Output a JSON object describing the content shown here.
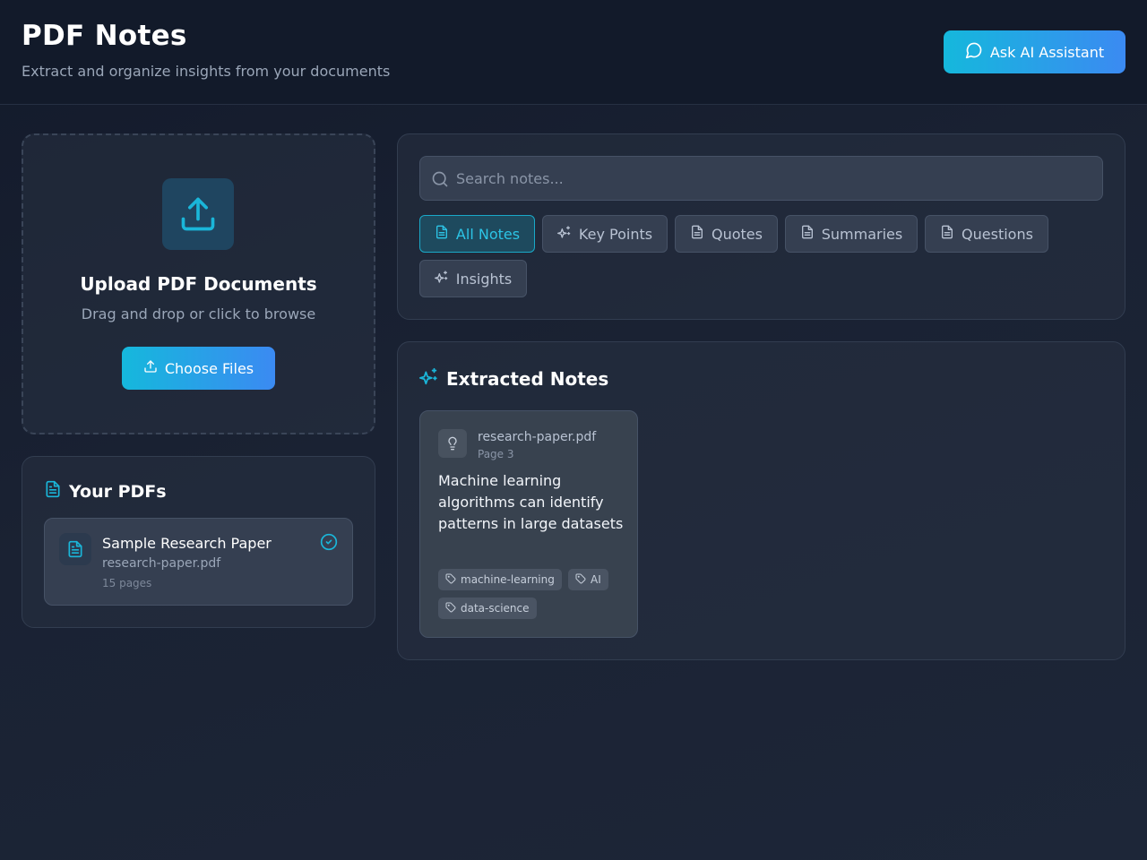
{
  "header": {
    "title": "PDF Notes",
    "subtitle": "Extract and organize insights from your documents",
    "ask_button": "Ask AI Assistant"
  },
  "upload": {
    "title": "Upload PDF Documents",
    "subtitle": "Drag and drop or click to browse",
    "button": "Choose Files"
  },
  "pdfs": {
    "heading": "Your PDFs",
    "items": [
      {
        "name": "Sample Research Paper",
        "file": "research-paper.pdf",
        "pages": "15 pages",
        "status": "selected"
      }
    ]
  },
  "search": {
    "placeholder": "Search notes...",
    "value": ""
  },
  "filters": [
    {
      "label": "All Notes",
      "icon": "file-text-icon",
      "active": true
    },
    {
      "label": "Key Points",
      "icon": "sparkles-icon",
      "active": false
    },
    {
      "label": "Quotes",
      "icon": "file-text-icon",
      "active": false
    },
    {
      "label": "Summaries",
      "icon": "file-text-icon",
      "active": false
    },
    {
      "label": "Questions",
      "icon": "file-text-icon",
      "active": false
    },
    {
      "label": "Insights",
      "icon": "sparkles-icon",
      "active": false
    }
  ],
  "notes": {
    "heading": "Extracted Notes",
    "items": [
      {
        "icon": "lightbulb-icon",
        "file": "research-paper.pdf",
        "page": "Page 3",
        "text": "Machine learning algorithms can identify patterns in large datasets",
        "tags": [
          "machine-learning",
          "AI",
          "data-science"
        ]
      }
    ]
  },
  "colors": {
    "accent": "#1ab6d9",
    "accent_gradient_end": "#3b8af2",
    "background": "#1a2233",
    "card": "#283142"
  }
}
